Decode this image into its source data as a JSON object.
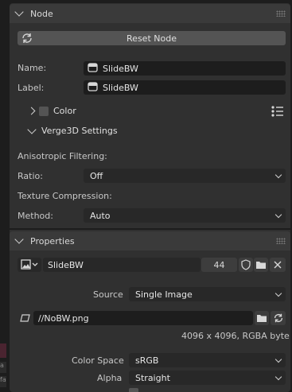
{
  "node_panel": {
    "title": "Node",
    "reset_label": "Reset Node",
    "name_label": "Name:",
    "name_value": "SlideBW",
    "label_label": "Label:",
    "label_value": "SlideBW",
    "color_label": "Color",
    "verge_label": "Verge3D Settings",
    "aniso_label": "Anisotropic Filtering:",
    "ratio_label": "Ratio:",
    "ratio_value": "Off",
    "compression_label": "Texture Compression:",
    "method_label": "Method:",
    "method_value": "Auto"
  },
  "properties_panel": {
    "title": "Properties",
    "image_name": "SlideBW",
    "user_count": "44",
    "source_label": "Source",
    "source_value": "Single Image",
    "file_path": "//NoBW.png",
    "image_info": "4096 x 4096,  RGBA byte",
    "color_space_label": "Color Space",
    "color_space_value": "sRGB",
    "alpha_label": "Alpha",
    "alpha_value": "Straight"
  },
  "left_strip": {
    "mark_a": "",
    "mark_b": "a",
    "mark_c": "fa"
  },
  "colors": {
    "panel_bg": "#303030",
    "header_bg": "#3a3a3a",
    "field_bg": "#1d1d1d",
    "button_bg": "#545454",
    "dropdown_bg": "#282828"
  }
}
